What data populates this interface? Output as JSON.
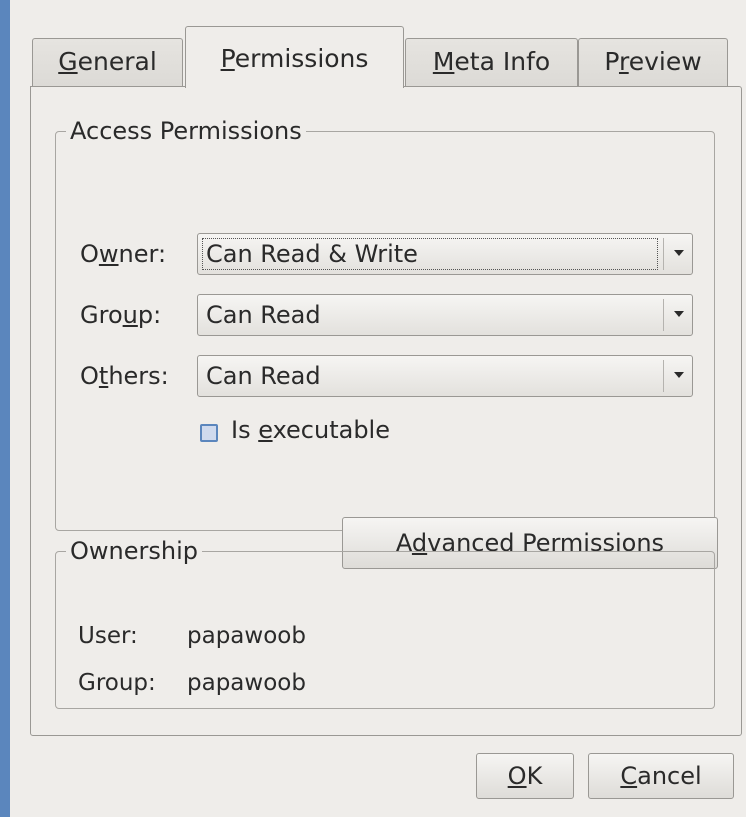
{
  "tabs": [
    {
      "label": "General",
      "mnemonic_index": 0,
      "active": false
    },
    {
      "label": "Permissions",
      "mnemonic_index": 0,
      "active": true
    },
    {
      "label": "Meta Info",
      "mnemonic_index": 0,
      "active": false
    },
    {
      "label": "Preview",
      "mnemonic_index": 1,
      "active": false
    }
  ],
  "access_permissions": {
    "legend": "Access Permissions",
    "owner": {
      "label": "Owner:",
      "value": "Can Read & Write"
    },
    "group": {
      "label": "Group:",
      "value": "Can Read"
    },
    "others": {
      "label": "Others:",
      "value": "Can Read"
    },
    "executable": {
      "label": "Is executable",
      "checked": false
    },
    "advanced_button": "Advanced Permissions"
  },
  "ownership": {
    "legend": "Ownership",
    "user_label": "User:",
    "user_value": "papawoob",
    "group_label": "Group:",
    "group_value": "papawoob"
  },
  "buttons": {
    "ok": "OK",
    "cancel": "Cancel"
  },
  "colors": {
    "desktop": "#5b86bd",
    "dialog_bg": "#efedea",
    "border": "#9a9894"
  }
}
